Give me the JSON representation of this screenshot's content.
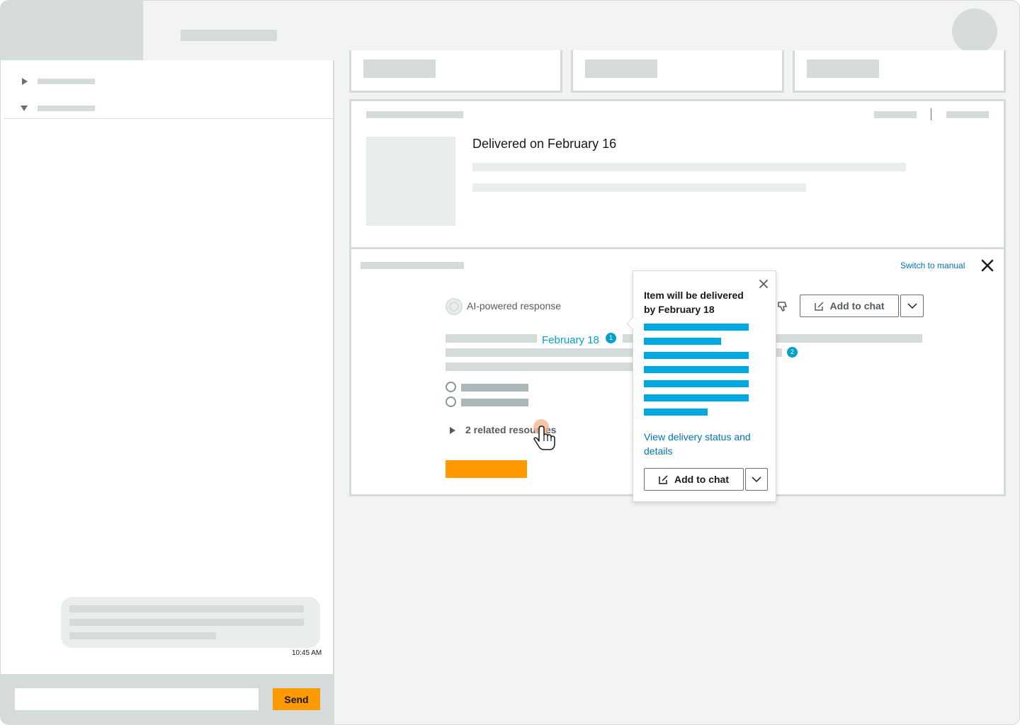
{
  "left_panel": {
    "chat_input": {
      "value": "",
      "placeholder": ""
    },
    "send_label": "Send",
    "message_time": "10:45 AM"
  },
  "order_card": {
    "delivery_title": "Delivered on February 16"
  },
  "assistant_panel": {
    "switch_label": "Switch to manual",
    "ai_label": "AI-powered response",
    "add_to_chat_label": "Add to chat",
    "date_link": "February 18",
    "citation_1": "1",
    "citation_2": "2",
    "related_resources": "2 related resources"
  },
  "popover": {
    "title": "Item will be delivered by February 18",
    "link": "View delivery status and details",
    "add_to_chat_label": "Add to chat"
  },
  "colors": {
    "accent_orange": "#ff9900",
    "link_blue": "#0073bb",
    "citation_blue": "#00a1c9",
    "placeholder_grey": "#d5dbdb"
  },
  "icons": [
    "caret-right-icon",
    "caret-down-icon",
    "close-icon",
    "ai-sparkle-icon",
    "thumbs-down-icon",
    "edit-icon",
    "chevron-down-icon",
    "pointer-cursor-icon"
  ]
}
